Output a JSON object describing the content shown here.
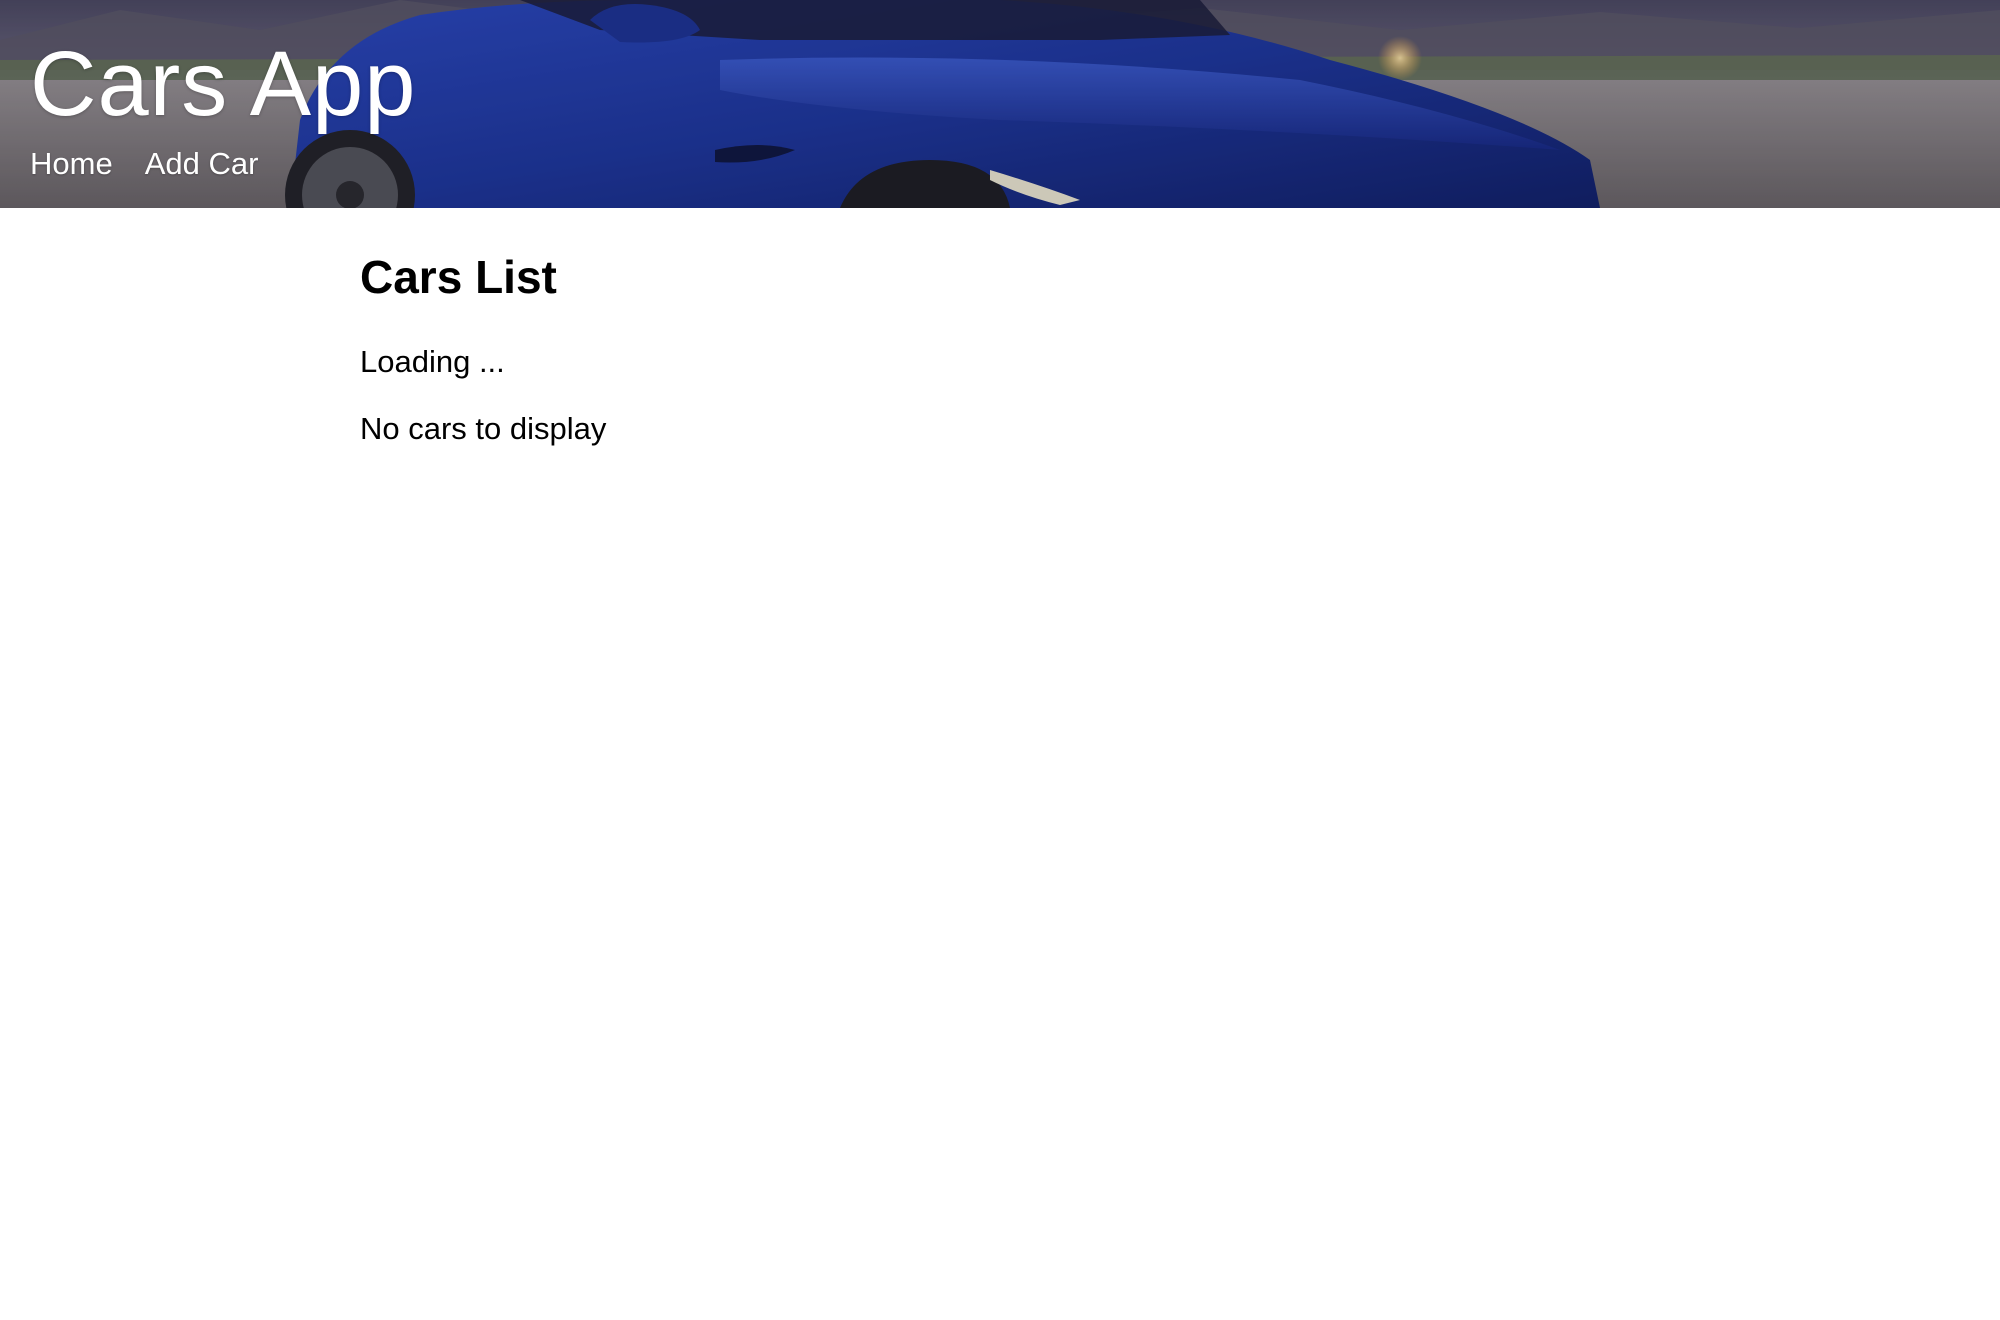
{
  "header": {
    "title": "Cars App",
    "nav": [
      {
        "label": "Home"
      },
      {
        "label": "Add Car"
      }
    ],
    "hero_image": "blue-sports-car-photo"
  },
  "main": {
    "heading": "Cars List",
    "loading_text": "Loading ...",
    "empty_text": "No cars to display"
  },
  "colors": {
    "car_blue": "#1f3a9e",
    "header_text": "#ffffff",
    "body_text": "#000000",
    "background": "#ffffff"
  }
}
